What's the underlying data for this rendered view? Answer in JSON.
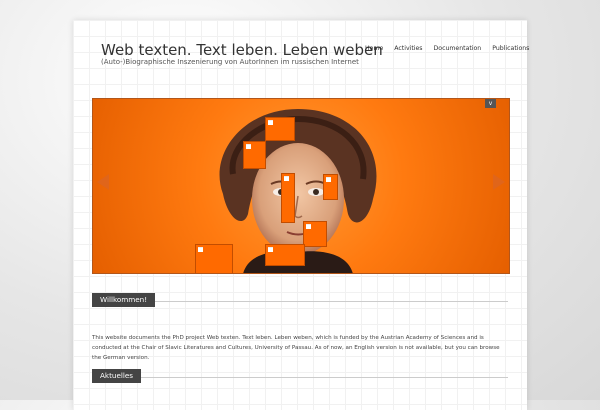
{
  "site": {
    "title": "Web texten. Text leben. Leben weben",
    "subtitle": "(Auto-)Biographische Inszenierung von AutorInnen im russischen Internet"
  },
  "nav": {
    "items": [
      "Home",
      "Activities",
      "Documentation",
      "Publications"
    ]
  },
  "slider": {
    "toggle_label": "v",
    "left_arrow": "arrow-left-icon",
    "right_arrow": "arrow-right-icon"
  },
  "sections": {
    "welcome_title": "Willkommen!",
    "welcome_text": "This website documents the PhD project Web texten. Text leben. Leben weben, which is funded by the Austrian Academy of Sciences and is conducted at the Chair of Slavic Literatures and Cultures, University of Passau. As of now, an English version is not available, but you can browse the German version.",
    "news_title": "Aktuelles"
  },
  "colors": {
    "accent": "#ff6a00",
    "header_bg": "#444444"
  }
}
